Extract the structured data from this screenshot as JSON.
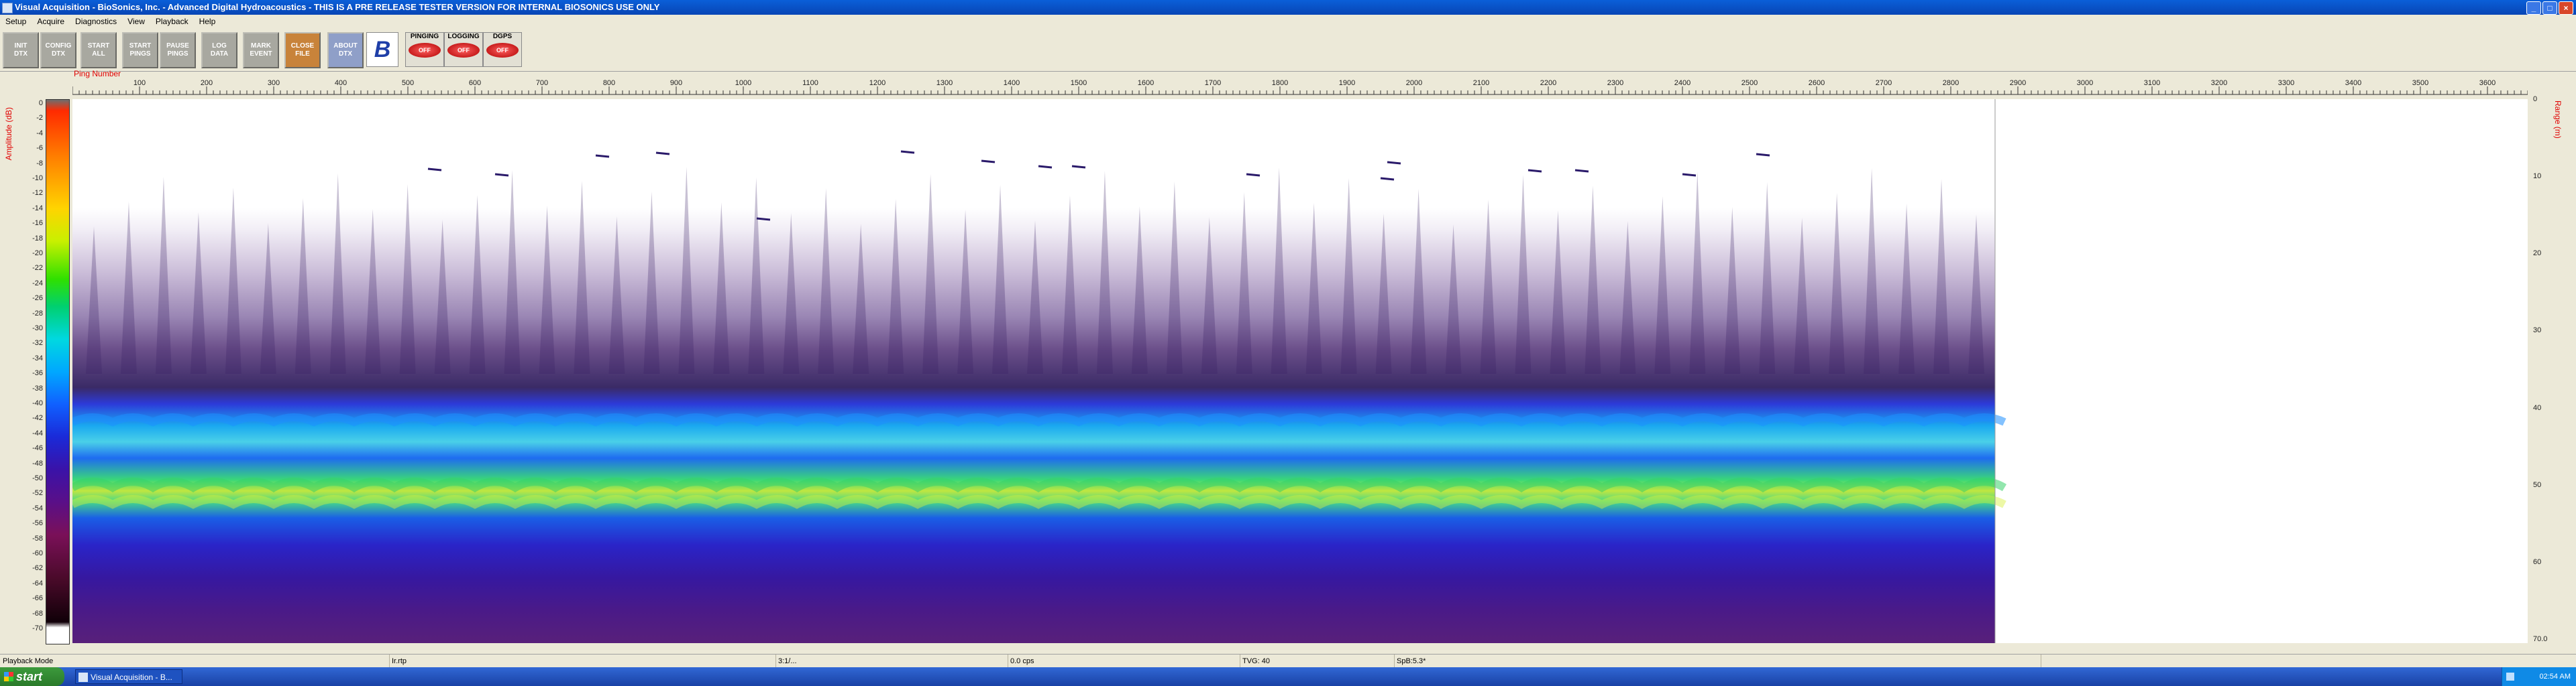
{
  "window": {
    "title": "Visual Acquisition  -  BioSonics, Inc.  -  Advanced Digital Hydroacoustics   -  THIS IS A PRE RELEASE TESTER VERSION FOR INTERNAL BIOSONICS USE ONLY",
    "controls": [
      "_",
      "□",
      "×"
    ]
  },
  "menu": [
    "Setup",
    "Acquire",
    "Diagnostics",
    "View",
    "Playback",
    "Help"
  ],
  "toolbar": {
    "buttons": [
      {
        "line1": "INIT",
        "line2": "DTX"
      },
      {
        "line1": "CONFIG",
        "line2": "DTX"
      },
      {
        "line1": "START",
        "line2": "ALL"
      },
      {
        "line1": "START",
        "line2": "PINGS"
      },
      {
        "line1": "PAUSE",
        "line2": "PINGS"
      },
      {
        "line1": "LOG",
        "line2": "DATA"
      },
      {
        "line1": "MARK",
        "line2": "EVENT"
      },
      {
        "line1": "CLOSE",
        "line2": "FILE"
      },
      {
        "line1": "ABOUT",
        "line2": "DTX"
      }
    ],
    "logo_icon": "biosonics-logo-icon",
    "indicators": [
      {
        "label": "PINGING",
        "state": "OFF"
      },
      {
        "label": "LOGGING",
        "state": "OFF"
      },
      {
        "label": "DGPS",
        "state": "OFF"
      }
    ]
  },
  "plot": {
    "x_label": "Ping Number",
    "amp_label": "Amplitude (dB)",
    "range_label": "Range (m)",
    "x_ticks": [
      "100",
      "200",
      "300",
      "400",
      "500",
      "600",
      "700",
      "800",
      "900",
      "1000",
      "1100",
      "1200",
      "1300",
      "1400",
      "1500",
      "1600",
      "1700",
      "1800",
      "1900",
      "2000",
      "2100",
      "2200",
      "2300",
      "2400",
      "2500",
      "2600",
      "2700",
      "2800",
      "2900",
      "3000",
      "3100",
      "3200",
      "3300",
      "3400",
      "3500",
      "3600"
    ],
    "amp_ticks": [
      "0",
      "-2",
      "-4",
      "-6",
      "-8",
      "-10",
      "-12",
      "-14",
      "-16",
      "-18",
      "-20",
      "-22",
      "-24",
      "-26",
      "-28",
      "-30",
      "-32",
      "-34",
      "-36",
      "-38",
      "-40",
      "-42",
      "-44",
      "-46",
      "-48",
      "-50",
      "-52",
      "-54",
      "-56",
      "-58",
      "-60",
      "-62",
      "-64",
      "-66",
      "-68",
      "-70"
    ],
    "range_ticks": [
      "0",
      "10",
      "20",
      "30",
      "40",
      "50",
      "60",
      "70.0"
    ],
    "data_extent_pings": 2866,
    "x_max_pings": 3660
  },
  "status": {
    "mode": "Playback Mode",
    "file": "Ir.rtp",
    "time": "3:1/...",
    "rate": "0.0 cps",
    "tvg": "TVG: 40",
    "sp": "SpB:5.3*"
  },
  "taskbar": {
    "start": "start",
    "item": "Visual Acquisition - B...",
    "clock": "02:54 AM"
  }
}
